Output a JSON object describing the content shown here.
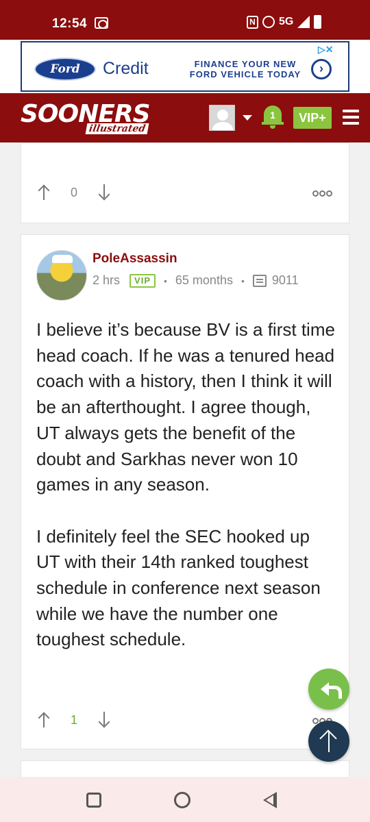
{
  "status_bar": {
    "time": "12:54",
    "network": "5G"
  },
  "ad": {
    "brand": "Ford",
    "product": "Credit",
    "tagline": "FINANCE YOUR NEW FORD VEHICLE TODAY",
    "close_glyph": "▷✕"
  },
  "header": {
    "logo_main": "SOONERS",
    "logo_sub": "illustrated",
    "notification_count": "1",
    "vip_label": "VIP+"
  },
  "feed": {
    "prev_post": {
      "vote_count": "0"
    },
    "post": {
      "username": "PoleAssassin",
      "time_ago": "2 hrs",
      "badge": "VIP",
      "membership": "65 months",
      "post_count": "9011",
      "paragraphs": [
        "I believe it’s because BV is a first time head coach. If he was a tenured head coach with a history, then I think it will be an afterthought. I agree though, UT always gets the benefit of the doubt and Sarkhas never won 10 games in any season.",
        "I definitely feel the SEC hooked up UT with their 14th ranked toughest schedule in conference next season while we have the number one toughest schedule."
      ],
      "vote_count": "1"
    }
  },
  "colors": {
    "brand": "#8b0d0d",
    "accent": "#8bc53f",
    "ford_blue": "#1b3f8f"
  }
}
